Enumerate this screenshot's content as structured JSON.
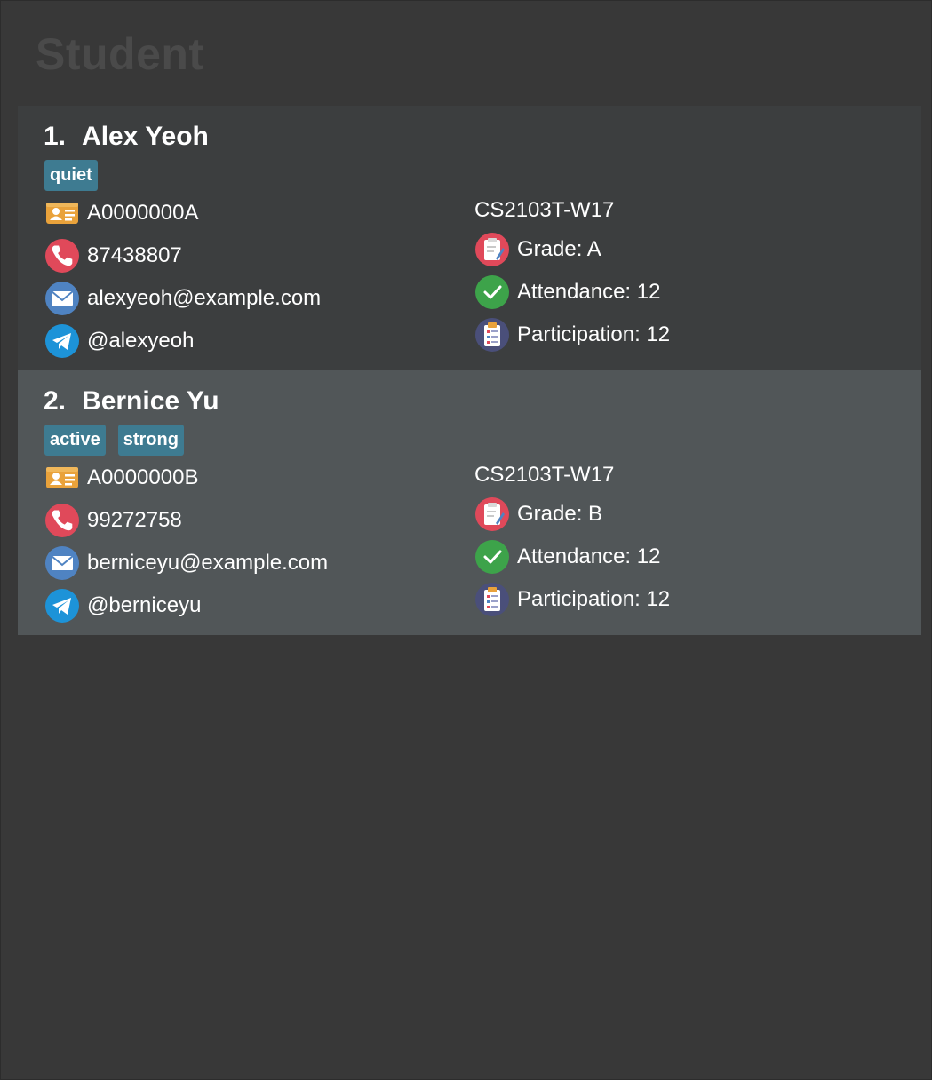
{
  "panel": {
    "title": "Student"
  },
  "students": [
    {
      "index": "1.",
      "name": "Alex Yeoh",
      "tags": [
        "quiet"
      ],
      "student_id": "A0000000A",
      "phone": "87438807",
      "email": "alexyeoh@example.com",
      "telegram": "@alexyeoh",
      "tutorial": "CS2103T-W17",
      "grade": "Grade: A",
      "attendance": "Attendance: 12",
      "participation": "Participation: 12"
    },
    {
      "index": "2.",
      "name": "Bernice Yu",
      "tags": [
        "active",
        "strong"
      ],
      "student_id": "A0000000B",
      "phone": "99272758",
      "email": "berniceyu@example.com",
      "telegram": "@berniceyu",
      "tutorial": "CS2103T-W17",
      "grade": "Grade: B",
      "attendance": "Attendance: 12",
      "participation": "Participation: 12"
    }
  ],
  "colors": {
    "background": "#383838",
    "card_odd": "#3c3e3f",
    "card_even": "#515658",
    "tag": "#3e7b91",
    "title": "#4a4a4a"
  },
  "icons": {
    "student_id": "id-card-icon",
    "phone": "phone-icon",
    "email": "email-icon",
    "telegram": "telegram-icon",
    "grade": "grade-clipboard-icon",
    "attendance": "attendance-check-icon",
    "participation": "participation-clipboard-icon"
  }
}
